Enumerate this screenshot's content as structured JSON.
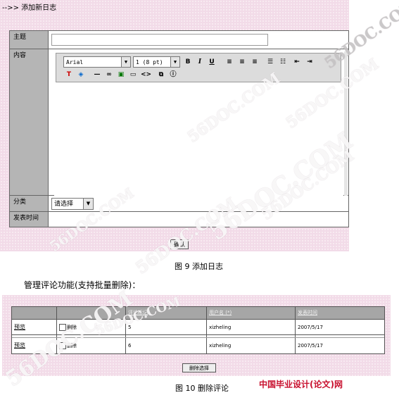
{
  "top_panel": {
    "header": "-->> 添加新日志",
    "fields": {
      "subject_label": "主题",
      "content_label": "内容",
      "category_label": "分类",
      "publish_time_label": "发表时间"
    },
    "toolbar": {
      "font_family": "Arial",
      "font_size": "1 (8 pt)",
      "bold": "B",
      "italic": "I",
      "underline": "U"
    },
    "category_select": {
      "value": "请选择"
    },
    "confirm_button": "确认"
  },
  "caption_fig9": "图 9 添加日志",
  "manage_text": "管理评论功能(支持批量删除)：",
  "comment_table": {
    "headers": [
      "",
      "",
      "评论标记",
      "用户名 (*)",
      "发表时间"
    ],
    "rows": [
      {
        "preview": "预览",
        "delete": "删除",
        "mark": "5",
        "user": "xizheling",
        "date": "2007/5/17"
      },
      {
        "preview": "预览",
        "delete": "删除",
        "mark": "6",
        "user": "xizheling",
        "date": "2007/5/17"
      }
    ]
  },
  "delete_selected_button": "删除选择",
  "caption_fig10": "图 10 删除评论",
  "watermark": "56DOC.COM",
  "site_logo": "中国毕业设计(论文)网"
}
